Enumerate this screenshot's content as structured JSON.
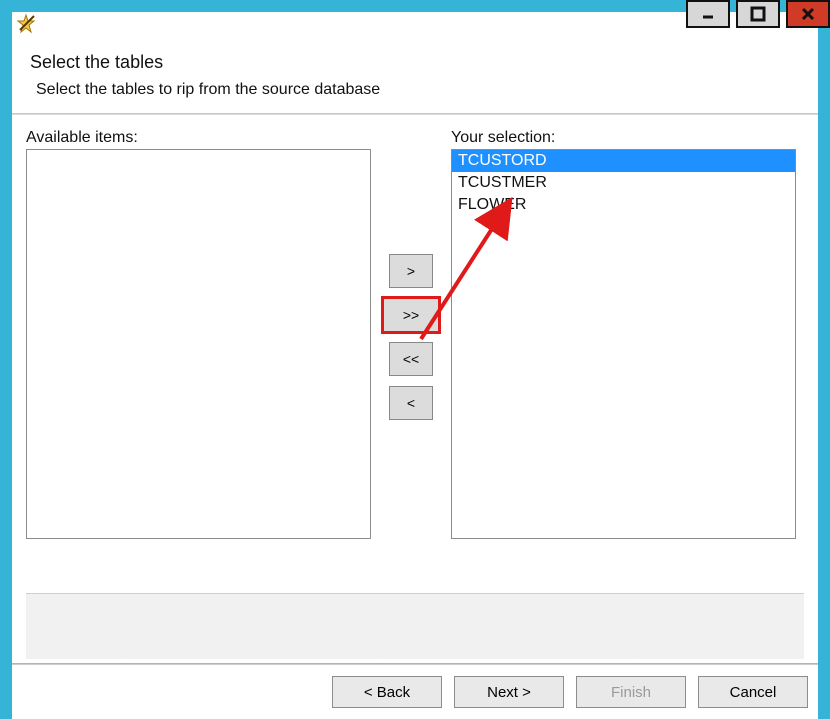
{
  "header": {
    "title": "Select the tables",
    "subtitle": "Select the tables to rip from the source database"
  },
  "labels": {
    "available": "Available items:",
    "selected": "Your selection:"
  },
  "available_items": [],
  "selected_items": [
    {
      "text": "TCUSTORD",
      "selected": true
    },
    {
      "text": "TCUSTMER",
      "selected": false
    },
    {
      "text": "FLOWER",
      "selected": false
    }
  ],
  "move_buttons": {
    "add": ">",
    "add_all": ">>",
    "remove_all": "<<",
    "remove": "<"
  },
  "nav": {
    "back": "< Back",
    "next": "Next >",
    "finish": "Finish",
    "cancel": "Cancel"
  }
}
